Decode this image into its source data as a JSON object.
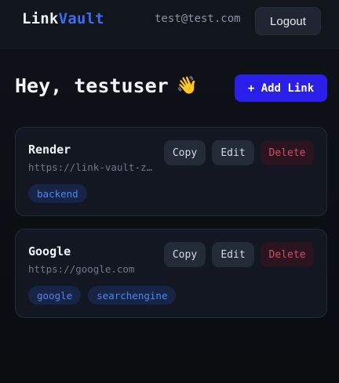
{
  "header": {
    "brand_part1": "Link",
    "brand_part2": "Vault",
    "user_email": "test@test.com",
    "logout_label": "Logout"
  },
  "main": {
    "greeting": "Hey, testuser",
    "greeting_emoji": "👋",
    "add_link_label": "+ Add Link"
  },
  "links": [
    {
      "title": "Render",
      "url": "https://link-vault-z…",
      "copy_label": "Copy",
      "edit_label": "Edit",
      "delete_label": "Delete",
      "tags": [
        "backend"
      ]
    },
    {
      "title": "Google",
      "url": "https://google.com",
      "copy_label": "Copy",
      "edit_label": "Edit",
      "delete_label": "Delete",
      "tags": [
        "google",
        "searchengine"
      ]
    }
  ],
  "colors": {
    "accent": "#2a1fe8",
    "brand_blue": "#3b6cf2",
    "danger": "#d84a62",
    "tag_text": "#4d86f0"
  }
}
